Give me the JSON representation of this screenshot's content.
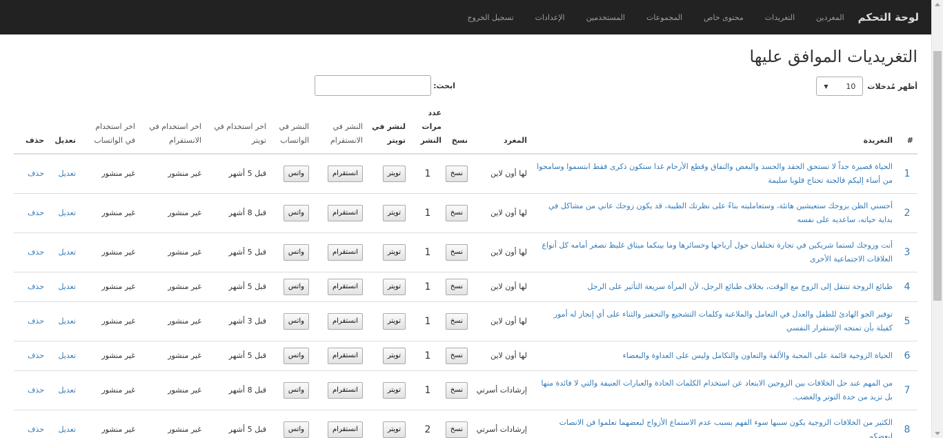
{
  "navbar": {
    "brand": "لوحة التحكم",
    "items": [
      "المغردين",
      "التغريدات",
      "محتوى خاص",
      "المجموعات",
      "المستخدمين",
      "الإعدادات",
      "تسجيل الخروج"
    ]
  },
  "page": {
    "title": "التغريديات الموافق عليها",
    "length_label": "أظهر مُدخلات",
    "length_value": "10",
    "search_label": "ابحث:"
  },
  "table": {
    "headers": {
      "index": "#",
      "tweet": "التغريدة",
      "tweeter": "المغرد",
      "copy": "نسخ",
      "post_count": "عدد مرات النشر",
      "twitter": "لنشر في تويتر",
      "instagram": "النشر في الانستقرام",
      "whatsapp": "النشر في الواتساب",
      "last_twitter": "اخر استخدام في تويتر",
      "last_instagram": "اخر استخدام في الانستقرام",
      "last_whatsapp": "اخر استخدام في الواتساب",
      "edit": "تعديل",
      "delete": "حذف"
    },
    "buttons": {
      "copy": "نسخ",
      "twitter": "تويتر",
      "instagram": "انستقرام",
      "whatsapp": "واتس"
    },
    "rows": [
      {
        "index": "1",
        "tweet": "الحياة قصيرة جداً لا تستحق الحقد والحسد والبغض والنفاق وقطع الأرحام غدا ستكون ذكرى فقط ابتسموا وسامحوا من أساء إليكم فالجنة تحتاج قلوبا سليمة",
        "tweeter": "لها أون لاين",
        "count": "1",
        "last_twitter": "قبل 5 أشهر",
        "last_instagram": "غير منشور",
        "last_whatsapp": "غير منشور",
        "edit": "تعديل",
        "delete": "حذف"
      },
      {
        "index": "2",
        "tweet": "أحسني الظن بزوجك ستعيشين هانئة، وستعامليته بناءً على نظرتك الطيبة، قد يكون زوجك عاني من مشاكل في بداية حياته، ساعديه على نفسه",
        "tweeter": "لها أون لاين",
        "count": "1",
        "last_twitter": "قبل 8 أشهر",
        "last_instagram": "غير منشور",
        "last_whatsapp": "غير منشور",
        "edit": "تعديل",
        "delete": "حذف"
      },
      {
        "index": "3",
        "tweet": "أنت وزوجك لستما شريكين في تجارة تختلفان حول أرباحها وخسائرها وما بينكما ميثاق غليظ تصغر أمامه كل أنواع العلاقات الاجتماعية الأخرى",
        "tweeter": "لها أون لاين",
        "count": "1",
        "last_twitter": "قبل 5 أشهر",
        "last_instagram": "غير منشور",
        "last_whatsapp": "غير منشور",
        "edit": "تعديل",
        "delete": "حذف"
      },
      {
        "index": "4",
        "tweet": "طبائع الزوجة تنتقل إلى الزوج مع الوقت، بخلاف طبائع الرجل، لأن المرأة سريعة التأثير على الرجل",
        "tweeter": "لها أون لاين",
        "count": "1",
        "last_twitter": "قبل 5 أشهر",
        "last_instagram": "غير منشور",
        "last_whatsapp": "غير منشور",
        "edit": "تعديل",
        "delete": "حذف"
      },
      {
        "index": "5",
        "tweet": "توفير الجو الهادئ للطفل والعدل في التعامل والملاعبة وكلمات التشجيع والتحفيز والثناء على أي إنجاز له أمور كفيلة بأن تمنحه الإستقرار النفسي",
        "tweeter": "لها أون لاين",
        "count": "1",
        "last_twitter": "قبل 3 أشهر",
        "last_instagram": "غير منشور",
        "last_whatsapp": "غير منشور",
        "edit": "تعديل",
        "delete": "حذف"
      },
      {
        "index": "6",
        "tweet": "الحياة الزوجية قائمة على المحبة والألفة والتعاون والتكامل وليس على العداوة والبغضاء",
        "tweeter": "لها أون لاين",
        "count": "1",
        "last_twitter": "قبل 5 أشهر",
        "last_instagram": "غير منشور",
        "last_whatsapp": "غير منشور",
        "edit": "تعديل",
        "delete": "حذف"
      },
      {
        "index": "7",
        "tweet": "من المهم عند حل الخلافات بين الزوجين الابتعاد عن استخدام الكلمات الحادة والعبارات العنيفة والتي لا فائدة منها بل تزيد من حدة التوتر والغضب.",
        "tweeter": "إرشادات أسرتي",
        "count": "1",
        "last_twitter": "قبل 8 أشهر",
        "last_instagram": "غير منشور",
        "last_whatsapp": "غير منشور",
        "edit": "تعديل",
        "delete": "حذف"
      },
      {
        "index": "8",
        "tweet": "الكثير من الخلافات الزوجية يكون سببها سوء الفهم بسبب عدم الاستماع الأزواج لبعضهما تعلموا فن الانصات لبعضكم",
        "tweeter": "إرشادات أسرتي",
        "count": "2",
        "last_twitter": "قبل 5 أشهر",
        "last_instagram": "غير منشور",
        "last_whatsapp": "غير منشور",
        "edit": "تعديل",
        "delete": "حذف"
      }
    ]
  }
}
